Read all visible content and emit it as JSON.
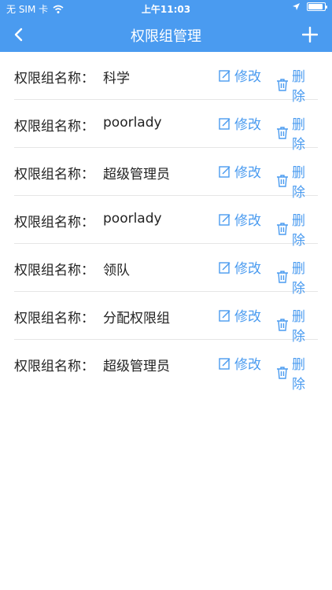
{
  "status": {
    "carrier": "无 SIM 卡",
    "time": "上午11:03",
    "icons": [
      "wifi-icon",
      "location-icon",
      "battery-icon"
    ]
  },
  "nav": {
    "title": "权限组管理",
    "back_icon": "chevron-left-icon",
    "add_icon": "plus-icon"
  },
  "colors": {
    "accent": "#4a9bf0",
    "divider": "#e6e6e6"
  },
  "list": {
    "items": [
      {
        "label": "权限组名称：",
        "name": "科学",
        "edit": "修改",
        "delete": "删除"
      },
      {
        "label": "权限组名称：",
        "name": "poorlady",
        "edit": "修改",
        "delete": "删除"
      },
      {
        "label": "权限组名称：",
        "name": "超级管理员",
        "edit": "修改",
        "delete": "删除"
      },
      {
        "label": "权限组名称：",
        "name": "poorlady",
        "edit": "修改",
        "delete": "删除"
      },
      {
        "label": "权限组名称：",
        "name": "领队",
        "edit": "修改",
        "delete": "删除"
      },
      {
        "label": "权限组名称：",
        "name": "分配权限组",
        "edit": "修改",
        "delete": "删除"
      },
      {
        "label": "权限组名称：",
        "name": "超级管理员",
        "edit": "修改",
        "delete": "删除"
      }
    ]
  }
}
